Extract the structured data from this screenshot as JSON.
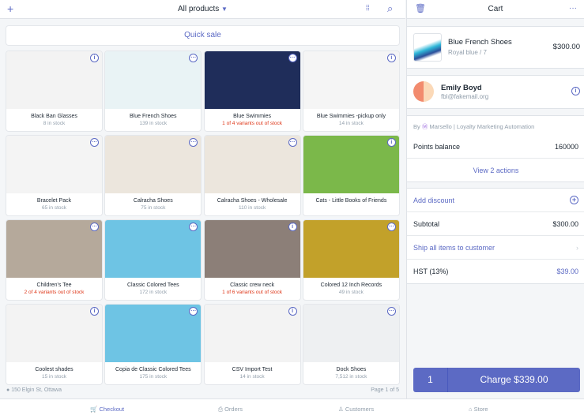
{
  "header": {
    "title": "All products",
    "add_icon": "plus-icon",
    "barcode_icon": "barcode-icon",
    "search_icon": "search-icon"
  },
  "quick_sale": "Quick sale",
  "products": [
    {
      "name": "Black Ban Glasses",
      "stock": "8 in stock",
      "warn": false,
      "badge": "i",
      "color": "#f3f3f3"
    },
    {
      "name": "Blue French Shoes",
      "stock": "139 in stock",
      "warn": false,
      "badge": "...",
      "color": "#e9f3f5"
    },
    {
      "name": "Blue Swimmies",
      "stock": "1 of 4 variants out of stock",
      "warn": true,
      "badge": "...",
      "color": "#1f2d5a"
    },
    {
      "name": "Blue Swimmies -pickup only",
      "stock": "14 in stock",
      "warn": false,
      "badge": "i",
      "color": "#f5f5f5"
    },
    {
      "name": "Bracelet Pack",
      "stock": "65 in stock",
      "warn": false,
      "badge": "...",
      "color": "#f4f4f4"
    },
    {
      "name": "Calracha Shoes",
      "stock": "75 in stock",
      "warn": false,
      "badge": "...",
      "color": "#ece6dd"
    },
    {
      "name": "Calracha Shoes - Wholesale",
      "stock": "110 in stock",
      "warn": false,
      "badge": "...",
      "color": "#ece6dd"
    },
    {
      "name": "Cats - Little Books of Friends",
      "stock": "",
      "warn": false,
      "badge": "i",
      "color": "#7bb84a"
    },
    {
      "name": "Children's Tee",
      "stock": "2 of 4 variants out of stock",
      "warn": true,
      "badge": "...",
      "color": "#b5a99b"
    },
    {
      "name": "Classic Colored Tees",
      "stock": "172 in stock",
      "warn": false,
      "badge": "...",
      "color": "#6ec4e4"
    },
    {
      "name": "Classic crew neck",
      "stock": "1 of 6 variants out of stock",
      "warn": true,
      "badge": "i",
      "color": "#8c7f78"
    },
    {
      "name": "Colored 12 Inch Records",
      "stock": "49 in stock",
      "warn": false,
      "badge": "...",
      "color": "#c2a12a"
    },
    {
      "name": "Coolest shades",
      "stock": "15 in stock",
      "warn": false,
      "badge": "i",
      "color": "#f3f3f3"
    },
    {
      "name": "Copia de Classic Colored Tees",
      "stock": "175 in stock",
      "warn": false,
      "badge": "...",
      "color": "#6ec4e4"
    },
    {
      "name": "CSV Import Test",
      "stock": "14 in stock",
      "warn": false,
      "badge": "i",
      "color": "#f3f3f3"
    },
    {
      "name": "Dock Shoes",
      "stock": "7,512 in stock",
      "warn": false,
      "badge": "...",
      "color": "#eef0f2"
    }
  ],
  "footer": {
    "location": "150 Elgin St, Ottawa",
    "page": "Page 1 of 5"
  },
  "cart": {
    "title": "Cart",
    "item": {
      "name": "Blue French Shoes",
      "variant": "Royal blue / 7",
      "price": "$300.00"
    },
    "customer": {
      "name": "Emily Boyd",
      "email": "fbl@fakemail.org"
    },
    "app": {
      "by": "By",
      "name": "Marsello | Loyalty Marketing Automation",
      "points_label": "Points balance",
      "points": "160000",
      "actions": "View 2 actions"
    },
    "add_discount": "Add discount",
    "subtotal_label": "Subtotal",
    "subtotal": "$300.00",
    "ship": "Ship all items to customer",
    "tax_label": "HST (13%)",
    "tax": "$39.00",
    "charge_qty": "1",
    "charge_label": "Charge $339.00"
  },
  "tabs": [
    {
      "label": "Checkout",
      "icon": "cart-icon"
    },
    {
      "label": "Orders",
      "icon": "orders-icon"
    },
    {
      "label": "Customers",
      "icon": "person-icon"
    },
    {
      "label": "Store",
      "icon": "store-icon"
    }
  ],
  "colors": {
    "accent": "#5c6ac4",
    "warn": "#de3618"
  }
}
